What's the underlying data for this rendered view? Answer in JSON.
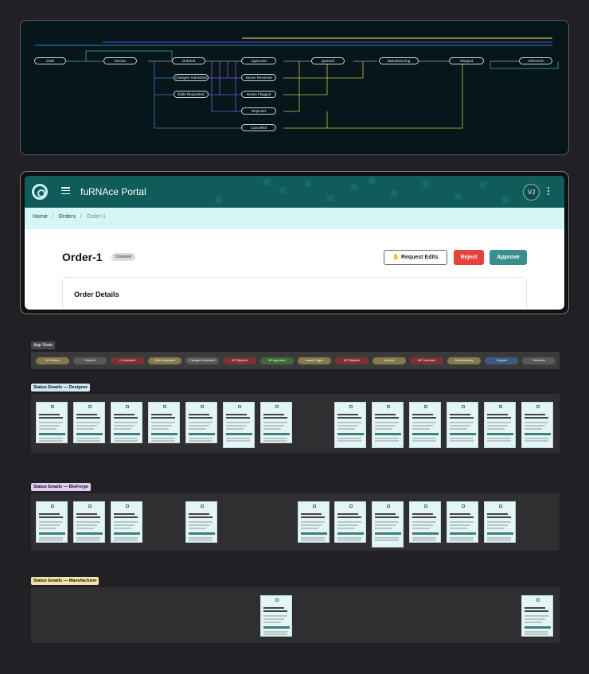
{
  "colors": {
    "teal": "#0f5c5b",
    "crumb_bg": "#d5f5f7",
    "reject": "#e4423a",
    "approve": "#3a8f8d"
  },
  "flow": {
    "nodes": [
      {
        "id": "draft",
        "label": "Draft"
      },
      {
        "id": "review",
        "label": "Review"
      },
      {
        "id": "ordered",
        "label": "Ordered"
      },
      {
        "id": "approved",
        "label": "Approved"
      },
      {
        "id": "queued",
        "label": "Queued"
      },
      {
        "id": "manufacturing",
        "label": "Manufacturing"
      },
      {
        "id": "shipped",
        "label": "Shipped"
      },
      {
        "id": "delivered",
        "label": "Delivered"
      },
      {
        "id": "changes_submitted",
        "label": "Changes Submitted"
      },
      {
        "id": "edits_requested",
        "label": "Edits Requested"
      },
      {
        "id": "issues_resolved",
        "label": "Issues Resolved"
      },
      {
        "id": "issues_flagged",
        "label": "Issues Flagged"
      },
      {
        "id": "rejected",
        "label": "Rejected"
      },
      {
        "id": "cancelled",
        "label": "Cancelled"
      }
    ]
  },
  "portal": {
    "title": "fuRNAce Portal",
    "avatar": "VJ",
    "breadcrumbs": [
      "Home",
      "Orders",
      "Order-1"
    ],
    "order_title": "Order-1",
    "status_badge": "Ordered",
    "buttons": {
      "request_edits": "Request Edits",
      "reject": "Reject",
      "approve": "Approve"
    },
    "card_title": "Order Details"
  },
  "app_state": {
    "label": "App State",
    "states": [
      {
        "label": "BF Review",
        "color": "#847a4c"
      },
      {
        "label": "Ordered",
        "color": "#58595c"
      },
      {
        "label": "D Cancelled",
        "color": "#7d3232"
      },
      {
        "label": "Edits Requested",
        "color": "#847a4c"
      },
      {
        "label": "Changes Submitted",
        "color": "#58595c"
      },
      {
        "label": "BF Rejected",
        "color": "#7d3232"
      },
      {
        "label": "BF Approved",
        "color": "#3f6b3b"
      },
      {
        "label": "Issues Flaged",
        "color": "#847a4c"
      },
      {
        "label": "MF Rejected",
        "color": "#7d3232"
      },
      {
        "label": "Queued",
        "color": "#847a4c"
      },
      {
        "label": "MF Canceled",
        "color": "#7d3232"
      },
      {
        "label": "Manufacturing",
        "color": "#847a4c"
      },
      {
        "label": "Shipped",
        "color": "#3c5a80"
      },
      {
        "label": "Delivered",
        "color": "#58595c"
      }
    ]
  },
  "email_rows": {
    "designer": {
      "label": "Status Emails — Designer",
      "color": "#cfe9f7"
    },
    "bioforge": {
      "label": "Status Emails — BioForge",
      "color": "#e2cdf5"
    },
    "manufacturer": {
      "label": "Status Emails — Manufacturer",
      "color": "#f6e3a3"
    }
  }
}
